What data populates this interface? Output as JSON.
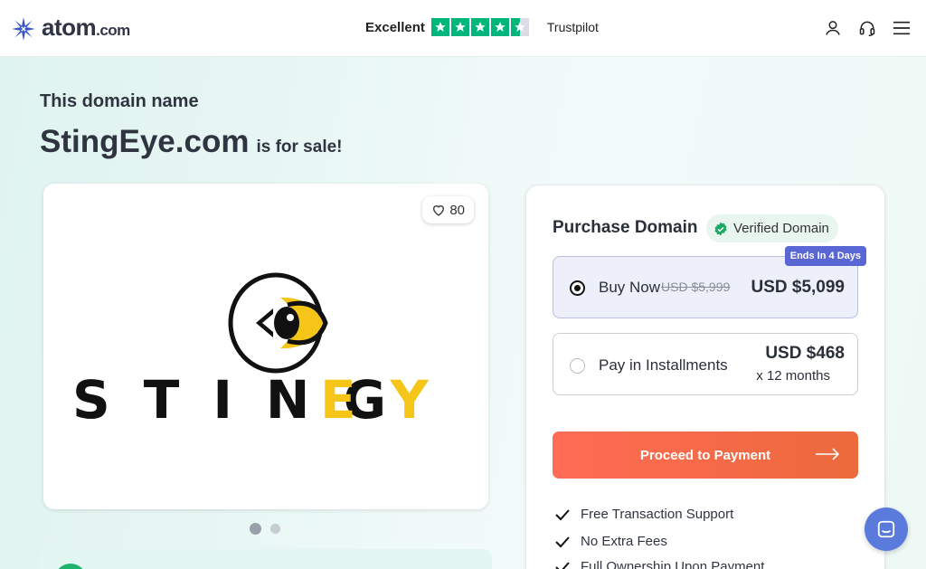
{
  "header": {
    "logo_main": "atom",
    "logo_suffix": ".com",
    "trust_label": "Excellent",
    "trust_rating": 4.5,
    "trust_brand": "Trustpilot",
    "icons": [
      "user-icon",
      "headset-icon",
      "menu-icon"
    ]
  },
  "hero": {
    "line1": "This domain name",
    "domain": "StingEye.com",
    "suffix": "is for sale!"
  },
  "image_card": {
    "likes": "80",
    "logo_word_dark": "STING",
    "logo_word_accent": "EYE",
    "carousel_total": 2,
    "carousel_active": 1
  },
  "purchase": {
    "title": "Purchase Domain",
    "verified_label": "Verified Domain",
    "buy_now": {
      "label": "Buy Now",
      "old_price": "USD $5,999",
      "price": "USD $5,099",
      "badge": "Ends In 4 Days",
      "selected": true
    },
    "installments": {
      "label": "Pay in Installments",
      "price": "USD $468",
      "term": "x 12 months",
      "selected": false
    },
    "cta_label": "Proceed to Payment",
    "features": [
      "Free Transaction Support",
      "No Extra Fees",
      "Full Ownership Upon Payment"
    ]
  },
  "colors": {
    "accent": "#00b67a",
    "cta_start": "#ff6b55",
    "cta_end": "#ec6a3c",
    "badge": "#5a66d4",
    "brand_yellow": "#f5c518"
  }
}
